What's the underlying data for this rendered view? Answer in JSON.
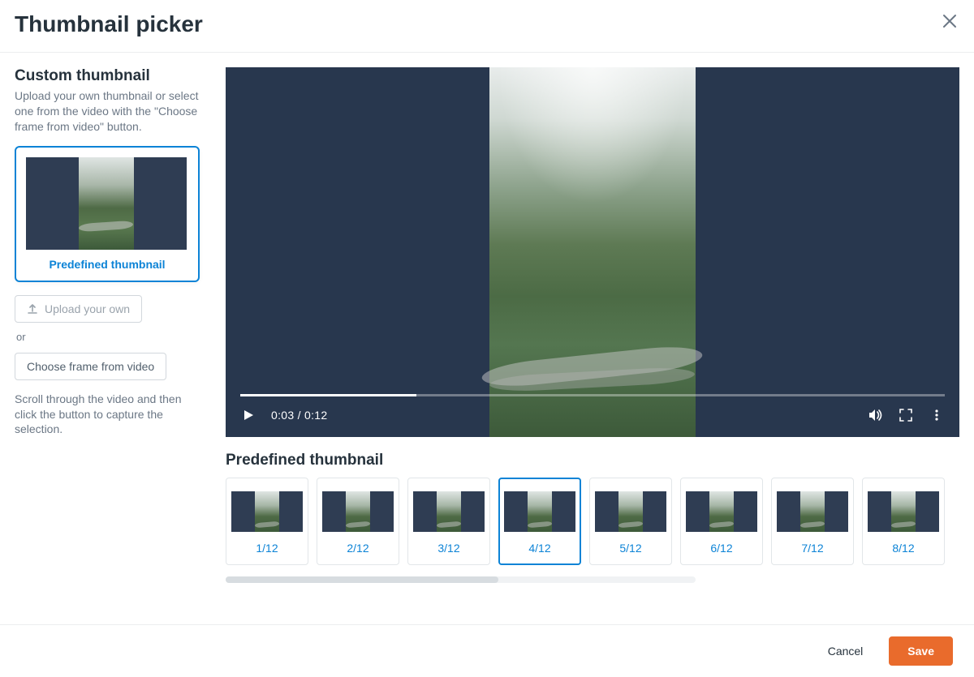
{
  "header": {
    "title": "Thumbnail picker"
  },
  "sidebar": {
    "heading": "Custom thumbnail",
    "description": "Upload your own thumbnail or select one from the video with the \"Choose frame from video\" button.",
    "selected_label": "Predefined thumbnail",
    "upload_label": "Upload your own",
    "or_label": "or",
    "choose_frame_label": "Choose frame from video",
    "hint": "Scroll through the video and then click the button to capture the selection."
  },
  "video": {
    "time_current": "0:03",
    "time_total": "0:12",
    "progress_pct": 25,
    "time_display": "0:03 / 0:12"
  },
  "thumbnails": {
    "section_title": "Predefined thumbnail",
    "selected_index": 3,
    "items": [
      {
        "label": "1/12"
      },
      {
        "label": "2/12"
      },
      {
        "label": "3/12"
      },
      {
        "label": "4/12"
      },
      {
        "label": "5/12"
      },
      {
        "label": "6/12"
      },
      {
        "label": "7/12"
      },
      {
        "label": "8/12"
      }
    ]
  },
  "footer": {
    "cancel_label": "Cancel",
    "save_label": "Save"
  },
  "colors": {
    "accent": "#0c83d6",
    "primary_button": "#e96b2c",
    "video_bg": "#28374e"
  }
}
